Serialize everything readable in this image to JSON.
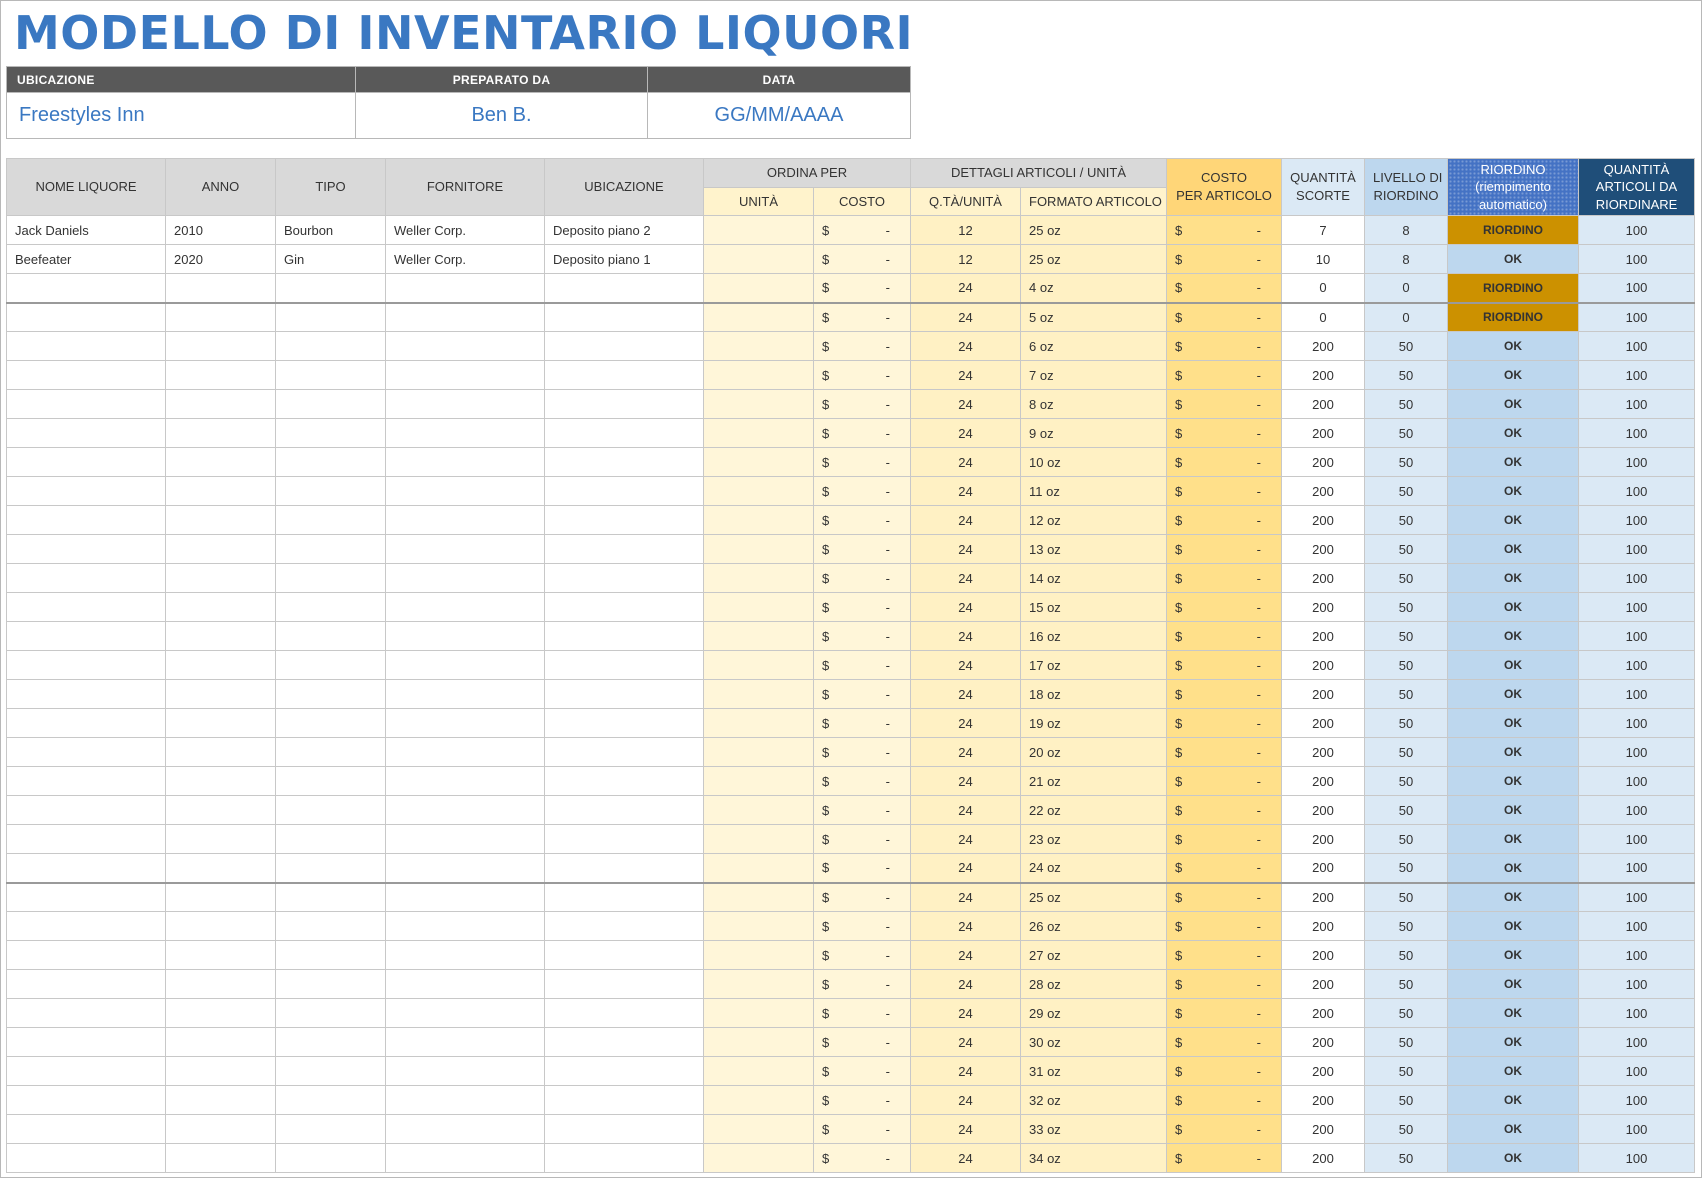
{
  "title": "MODELLO DI INVENTARIO LIQUORI",
  "info": {
    "labels": [
      "UBICAZIONE",
      "PREPARATO DA",
      "DATA"
    ],
    "values": [
      "Freestyles Inn",
      "Ben B.",
      "GG/MM/AAAA"
    ]
  },
  "headers": {
    "nome": "NOME LIQUORE",
    "anno": "ANNO",
    "tipo": "TIPO",
    "fornitore": "FORNITORE",
    "ubicazione": "UBICAZIONE",
    "ordina_per": "ORDINA PER",
    "dettagli": "DETTAGLI ARTICOLI / UNITÀ",
    "costo_articolo": [
      "COSTO",
      "PER ARTICOLO"
    ],
    "quantita_scorte": [
      "QUANTITÀ",
      "SCORTE"
    ],
    "livello": [
      "LIVELLO DI",
      "RIORDINO"
    ],
    "riordino": [
      "RIORDINO",
      "(riempimento",
      "automatico)"
    ],
    "qta_riordinare": [
      "QUANTITÀ",
      "ARTICOLI DA",
      "RIORDINARE"
    ],
    "unita": "UNITÀ",
    "costo": "COSTO",
    "qta_unita": "Q.TÀ/UNITÀ",
    "formato": "FORMATO ARTICOLO"
  },
  "currency_symbol": "$",
  "dash": "-",
  "rows": [
    {
      "nome": "Jack Daniels",
      "anno": "2010",
      "tipo": "Bourbon",
      "fornitore": "Weller Corp.",
      "ubicazione": "Deposito piano 2",
      "qta": "12",
      "formato": "25 oz",
      "scorte": "7",
      "livello": "8",
      "stato": "RIORDINO",
      "da_riordinare": "100"
    },
    {
      "nome": "Beefeater",
      "anno": "2020",
      "tipo": "Gin",
      "fornitore": "Weller Corp.",
      "ubicazione": "Deposito piano 1",
      "qta": "12",
      "formato": "25 oz",
      "scorte": "10",
      "livello": "8",
      "stato": "OK",
      "da_riordinare": "100"
    },
    {
      "nome": "",
      "anno": "",
      "tipo": "",
      "fornitore": "",
      "ubicazione": "",
      "qta": "24",
      "formato": "4 oz",
      "scorte": "0",
      "livello": "0",
      "stato": "RIORDINO",
      "da_riordinare": "100"
    },
    {
      "nome": "",
      "anno": "",
      "tipo": "",
      "fornitore": "",
      "ubicazione": "",
      "qta": "24",
      "formato": "5 oz",
      "scorte": "0",
      "livello": "0",
      "stato": "RIORDINO",
      "da_riordinare": "100"
    },
    {
      "nome": "",
      "anno": "",
      "tipo": "",
      "fornitore": "",
      "ubicazione": "",
      "qta": "24",
      "formato": "6 oz",
      "scorte": "200",
      "livello": "50",
      "stato": "OK",
      "da_riordinare": "100"
    },
    {
      "nome": "",
      "anno": "",
      "tipo": "",
      "fornitore": "",
      "ubicazione": "",
      "qta": "24",
      "formato": "7 oz",
      "scorte": "200",
      "livello": "50",
      "stato": "OK",
      "da_riordinare": "100"
    },
    {
      "nome": "",
      "anno": "",
      "tipo": "",
      "fornitore": "",
      "ubicazione": "",
      "qta": "24",
      "formato": "8 oz",
      "scorte": "200",
      "livello": "50",
      "stato": "OK",
      "da_riordinare": "100"
    },
    {
      "nome": "",
      "anno": "",
      "tipo": "",
      "fornitore": "",
      "ubicazione": "",
      "qta": "24",
      "formato": "9 oz",
      "scorte": "200",
      "livello": "50",
      "stato": "OK",
      "da_riordinare": "100"
    },
    {
      "nome": "",
      "anno": "",
      "tipo": "",
      "fornitore": "",
      "ubicazione": "",
      "qta": "24",
      "formato": "10 oz",
      "scorte": "200",
      "livello": "50",
      "stato": "OK",
      "da_riordinare": "100"
    },
    {
      "nome": "",
      "anno": "",
      "tipo": "",
      "fornitore": "",
      "ubicazione": "",
      "qta": "24",
      "formato": "11 oz",
      "scorte": "200",
      "livello": "50",
      "stato": "OK",
      "da_riordinare": "100"
    },
    {
      "nome": "",
      "anno": "",
      "tipo": "",
      "fornitore": "",
      "ubicazione": "",
      "qta": "24",
      "formato": "12 oz",
      "scorte": "200",
      "livello": "50",
      "stato": "OK",
      "da_riordinare": "100"
    },
    {
      "nome": "",
      "anno": "",
      "tipo": "",
      "fornitore": "",
      "ubicazione": "",
      "qta": "24",
      "formato": "13 oz",
      "scorte": "200",
      "livello": "50",
      "stato": "OK",
      "da_riordinare": "100"
    },
    {
      "nome": "",
      "anno": "",
      "tipo": "",
      "fornitore": "",
      "ubicazione": "",
      "qta": "24",
      "formato": "14 oz",
      "scorte": "200",
      "livello": "50",
      "stato": "OK",
      "da_riordinare": "100"
    },
    {
      "nome": "",
      "anno": "",
      "tipo": "",
      "fornitore": "",
      "ubicazione": "",
      "qta": "24",
      "formato": "15 oz",
      "scorte": "200",
      "livello": "50",
      "stato": "OK",
      "da_riordinare": "100"
    },
    {
      "nome": "",
      "anno": "",
      "tipo": "",
      "fornitore": "",
      "ubicazione": "",
      "qta": "24",
      "formato": "16 oz",
      "scorte": "200",
      "livello": "50",
      "stato": "OK",
      "da_riordinare": "100"
    },
    {
      "nome": "",
      "anno": "",
      "tipo": "",
      "fornitore": "",
      "ubicazione": "",
      "qta": "24",
      "formato": "17 oz",
      "scorte": "200",
      "livello": "50",
      "stato": "OK",
      "da_riordinare": "100"
    },
    {
      "nome": "",
      "anno": "",
      "tipo": "",
      "fornitore": "",
      "ubicazione": "",
      "qta": "24",
      "formato": "18 oz",
      "scorte": "200",
      "livello": "50",
      "stato": "OK",
      "da_riordinare": "100"
    },
    {
      "nome": "",
      "anno": "",
      "tipo": "",
      "fornitore": "",
      "ubicazione": "",
      "qta": "24",
      "formato": "19 oz",
      "scorte": "200",
      "livello": "50",
      "stato": "OK",
      "da_riordinare": "100"
    },
    {
      "nome": "",
      "anno": "",
      "tipo": "",
      "fornitore": "",
      "ubicazione": "",
      "qta": "24",
      "formato": "20 oz",
      "scorte": "200",
      "livello": "50",
      "stato": "OK",
      "da_riordinare": "100"
    },
    {
      "nome": "",
      "anno": "",
      "tipo": "",
      "fornitore": "",
      "ubicazione": "",
      "qta": "24",
      "formato": "21 oz",
      "scorte": "200",
      "livello": "50",
      "stato": "OK",
      "da_riordinare": "100"
    },
    {
      "nome": "",
      "anno": "",
      "tipo": "",
      "fornitore": "",
      "ubicazione": "",
      "qta": "24",
      "formato": "22 oz",
      "scorte": "200",
      "livello": "50",
      "stato": "OK",
      "da_riordinare": "100"
    },
    {
      "nome": "",
      "anno": "",
      "tipo": "",
      "fornitore": "",
      "ubicazione": "",
      "qta": "24",
      "formato": "23 oz",
      "scorte": "200",
      "livello": "50",
      "stato": "OK",
      "da_riordinare": "100"
    },
    {
      "nome": "",
      "anno": "",
      "tipo": "",
      "fornitore": "",
      "ubicazione": "",
      "qta": "24",
      "formato": "24 oz",
      "scorte": "200",
      "livello": "50",
      "stato": "OK",
      "da_riordinare": "100"
    },
    {
      "nome": "",
      "anno": "",
      "tipo": "",
      "fornitore": "",
      "ubicazione": "",
      "qta": "24",
      "formato": "25 oz",
      "scorte": "200",
      "livello": "50",
      "stato": "OK",
      "da_riordinare": "100"
    },
    {
      "nome": "",
      "anno": "",
      "tipo": "",
      "fornitore": "",
      "ubicazione": "",
      "qta": "24",
      "formato": "26 oz",
      "scorte": "200",
      "livello": "50",
      "stato": "OK",
      "da_riordinare": "100"
    },
    {
      "nome": "",
      "anno": "",
      "tipo": "",
      "fornitore": "",
      "ubicazione": "",
      "qta": "24",
      "formato": "27 oz",
      "scorte": "200",
      "livello": "50",
      "stato": "OK",
      "da_riordinare": "100"
    },
    {
      "nome": "",
      "anno": "",
      "tipo": "",
      "fornitore": "",
      "ubicazione": "",
      "qta": "24",
      "formato": "28 oz",
      "scorte": "200",
      "livello": "50",
      "stato": "OK",
      "da_riordinare": "100"
    },
    {
      "nome": "",
      "anno": "",
      "tipo": "",
      "fornitore": "",
      "ubicazione": "",
      "qta": "24",
      "formato": "29 oz",
      "scorte": "200",
      "livello": "50",
      "stato": "OK",
      "da_riordinare": "100"
    },
    {
      "nome": "",
      "anno": "",
      "tipo": "",
      "fornitore": "",
      "ubicazione": "",
      "qta": "24",
      "formato": "30 oz",
      "scorte": "200",
      "livello": "50",
      "stato": "OK",
      "da_riordinare": "100"
    },
    {
      "nome": "",
      "anno": "",
      "tipo": "",
      "fornitore": "",
      "ubicazione": "",
      "qta": "24",
      "formato": "31 oz",
      "scorte": "200",
      "livello": "50",
      "stato": "OK",
      "da_riordinare": "100"
    },
    {
      "nome": "",
      "anno": "",
      "tipo": "",
      "fornitore": "",
      "ubicazione": "",
      "qta": "24",
      "formato": "32 oz",
      "scorte": "200",
      "livello": "50",
      "stato": "OK",
      "da_riordinare": "100"
    },
    {
      "nome": "",
      "anno": "",
      "tipo": "",
      "fornitore": "",
      "ubicazione": "",
      "qta": "24",
      "formato": "33 oz",
      "scorte": "200",
      "livello": "50",
      "stato": "OK",
      "da_riordinare": "100"
    },
    {
      "nome": "",
      "anno": "",
      "tipo": "",
      "fornitore": "",
      "ubicazione": "",
      "qta": "24",
      "formato": "34 oz",
      "scorte": "200",
      "livello": "50",
      "stato": "OK",
      "da_riordinare": "100"
    }
  ]
}
